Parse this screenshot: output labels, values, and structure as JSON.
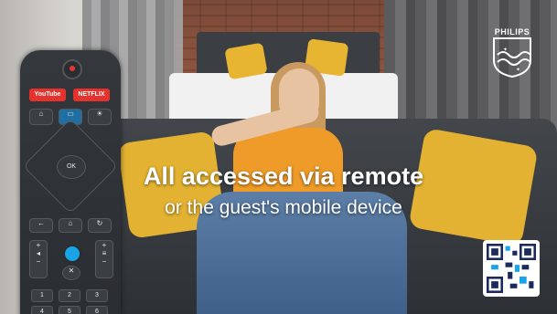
{
  "headline": "All accessed via remote",
  "subline": "or the guest's mobile device",
  "brand": {
    "name": "PHILIPS",
    "logo_icon": "philips-shield-icon",
    "accent": "#1aa4e8"
  },
  "remote": {
    "youtube_label": "YouTube",
    "netflix_label": "NETFLIX",
    "ok_label": "OK",
    "numbers": [
      "1",
      "2",
      "3",
      "4",
      "5",
      "6"
    ]
  },
  "qr_code_icon": "qr-code-icon"
}
